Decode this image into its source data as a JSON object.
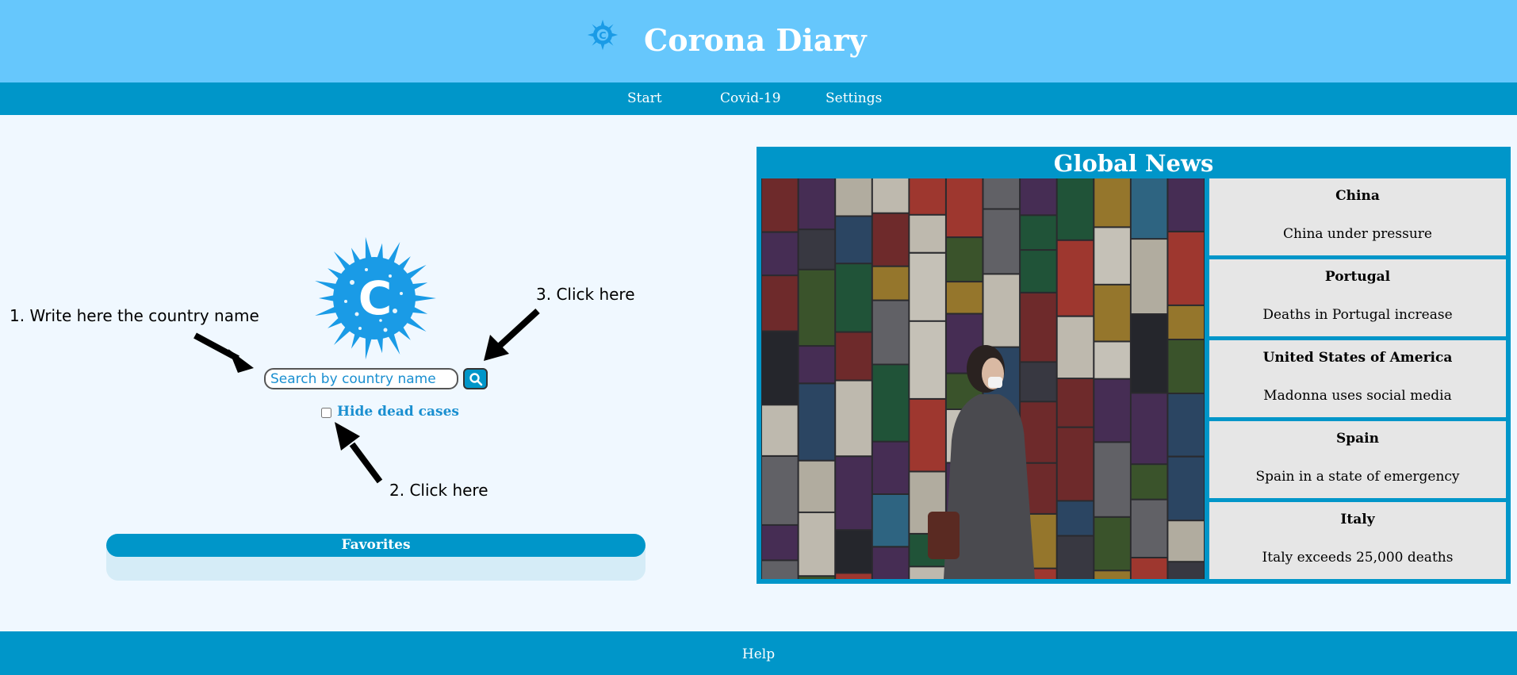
{
  "header": {
    "title": "Corona Diary",
    "logo_icon": "virus-logo-icon",
    "logo_letter": "C"
  },
  "nav": {
    "items": [
      {
        "label": "Start"
      },
      {
        "label": "Covid-19"
      },
      {
        "label": "Settings"
      }
    ]
  },
  "search": {
    "placeholder": "Search by country name",
    "value": "",
    "button_icon": "search-icon",
    "hide_dead_label": "Hide dead cases",
    "hide_dead_checked": false
  },
  "hints": {
    "step1": "1. Write here the country name",
    "step2": "2. Click here",
    "step3": "3. Click here"
  },
  "favorites": {
    "title": "Favorites",
    "items": []
  },
  "news": {
    "title": "Global News",
    "items": [
      {
        "country": "China",
        "headline": "China under pressure"
      },
      {
        "country": "Portugal",
        "headline": "Deaths in Portugal increase"
      },
      {
        "country": "United States of America",
        "headline": "Madonna uses social media"
      },
      {
        "country": "Spain",
        "headline": "Spain in a state of emergency"
      },
      {
        "country": "Italy",
        "headline": "Italy exceeds 25,000 deaths"
      }
    ]
  },
  "footer": {
    "help_label": "Help"
  },
  "colors": {
    "header_bg": "#66c7fc",
    "nav_bg": "#0096c9",
    "page_bg": "#f0f8ff",
    "accent": "#1a8fd0",
    "news_item_bg": "#e6e6e6"
  }
}
